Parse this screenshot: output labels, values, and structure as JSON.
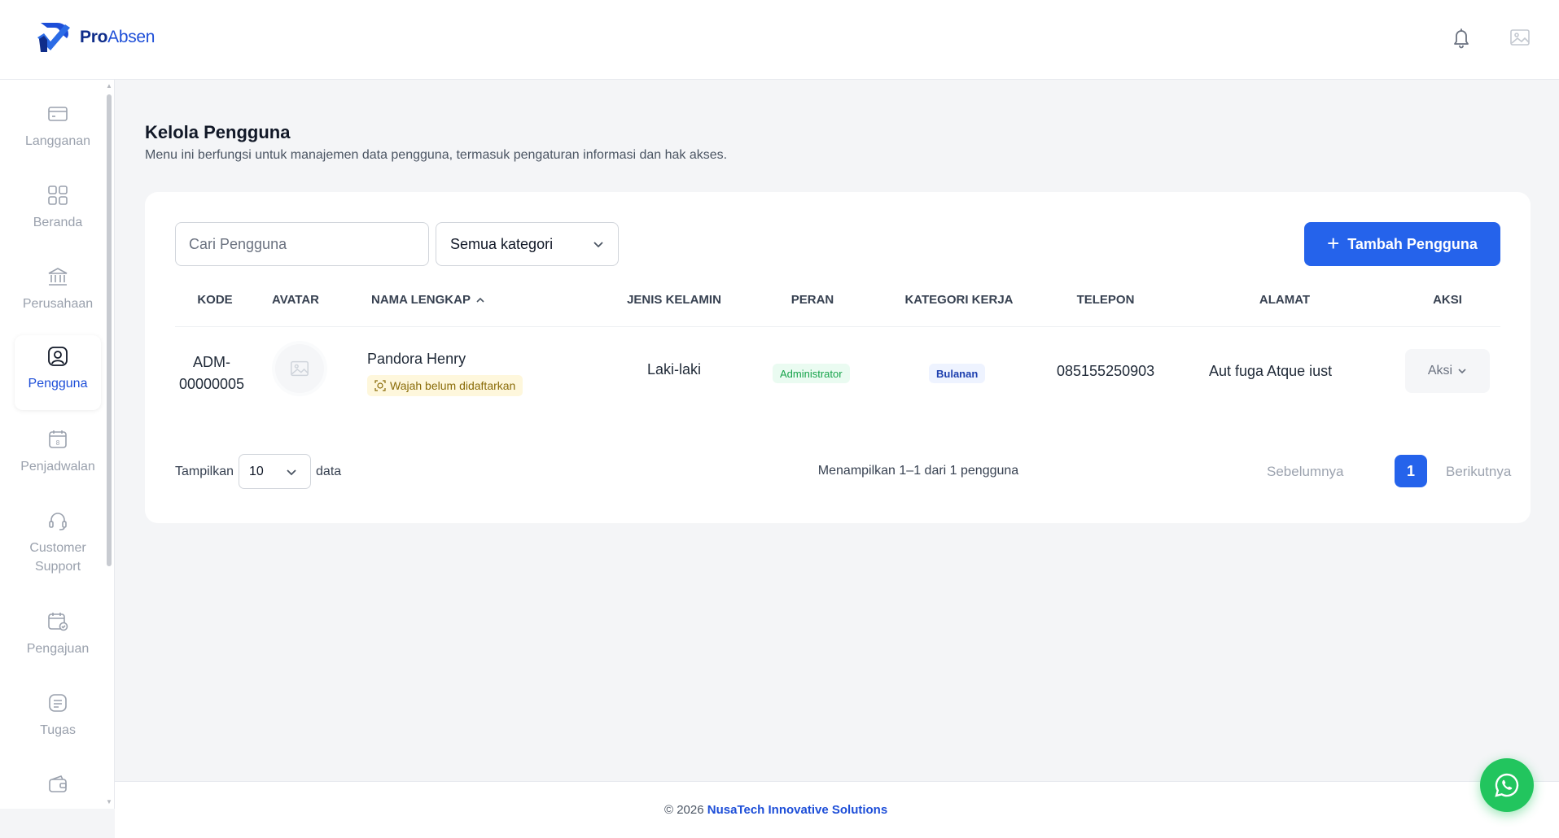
{
  "brand": {
    "name_bold": "Pro",
    "name_rest": "Absen"
  },
  "sidebar": {
    "items": [
      {
        "label": "Langganan",
        "icon": "credit-card-icon"
      },
      {
        "label": "Beranda",
        "icon": "dashboard-grid-icon"
      },
      {
        "label": "Perusahaan",
        "icon": "bank-building-icon"
      },
      {
        "label": "Pengguna",
        "icon": "user-circle-icon",
        "active": true
      },
      {
        "label": "Penjadwalan",
        "icon": "calendar-icon",
        "badge": "8"
      },
      {
        "label": "Customer Support",
        "icon": "headset-icon"
      },
      {
        "label": "Pengajuan",
        "icon": "calendar-check-icon"
      },
      {
        "label": "Tugas",
        "icon": "task-list-icon"
      },
      {
        "label": "",
        "icon": "wallet-icon"
      }
    ]
  },
  "page": {
    "title": "Kelola Pengguna",
    "description": "Menu ini berfungsi untuk manajemen data pengguna, termasuk pengaturan informasi dan hak akses."
  },
  "toolbar": {
    "search_placeholder": "Cari Pengguna",
    "category_selected": "Semua kategori",
    "add_label": "Tambah Pengguna"
  },
  "table": {
    "headers": [
      "KODE",
      "AVATAR",
      "NAMA LENGKAP",
      "JENIS KELAMIN",
      "PERAN",
      "KATEGORI KERJA",
      "TELEPON",
      "ALAMAT",
      "AKSI"
    ],
    "rows": [
      {
        "code_line1": "ADM-",
        "code_line2": "00000005",
        "name": "Pandora Henry",
        "face_status": "Wajah belum didaftarkan",
        "gender": "Laki-laki",
        "role": "Administrator",
        "work_category": "Bulanan",
        "phone": "085155250903",
        "address": "Aut fuga Atque iust",
        "action_label": "Aksi"
      }
    ]
  },
  "pagination": {
    "show_label": "Tampilkan",
    "per_page": "10",
    "data_label": "data",
    "summary": "Menampilkan 1–1 dari 1 pengguna",
    "prev_label": "Sebelumnya",
    "current_page": "1",
    "next_label": "Berikutnya"
  },
  "footer": {
    "copyright": "© 2026 ",
    "company": "NusaTech Innovative Solutions"
  },
  "colors": {
    "primary": "#2563eb",
    "success": "#16a34a",
    "whatsapp": "#22c55e"
  }
}
